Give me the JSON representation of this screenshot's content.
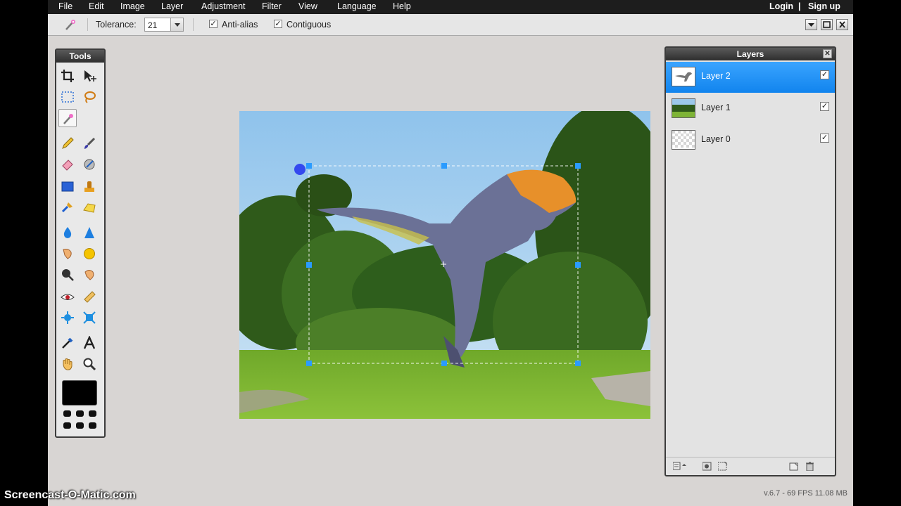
{
  "menu": {
    "items": [
      "File",
      "Edit",
      "Image",
      "Layer",
      "Adjustment",
      "Filter",
      "View",
      "Language",
      "Help"
    ],
    "login": "Login",
    "separator": "|",
    "signup": "Sign up"
  },
  "options": {
    "tolerance_label": "Tolerance:",
    "tolerance_value": "21",
    "antialias_label": "Anti-alias",
    "antialias_checked": true,
    "contiguous_label": "Contiguous",
    "contiguous_checked": true,
    "checkmark": "✓"
  },
  "tools": {
    "title": "Tools",
    "active_tool": "magic-wand",
    "foreground_color": "#000000"
  },
  "layers": {
    "title": "Layers",
    "close": "✕",
    "items": [
      {
        "name": "Layer 2",
        "visible": true,
        "selected": true
      },
      {
        "name": "Layer 1",
        "visible": true,
        "selected": false
      },
      {
        "name": "Layer 0",
        "visible": true,
        "selected": false
      }
    ]
  },
  "status": "v.6.7 - 69 FPS 11.08 MB",
  "watermark": "Screencast-O-Matic.com",
  "colors": {
    "selected_layer": "#1f8df2",
    "menubar": "#1d1d1d",
    "workspace": "#d8d5d3"
  }
}
